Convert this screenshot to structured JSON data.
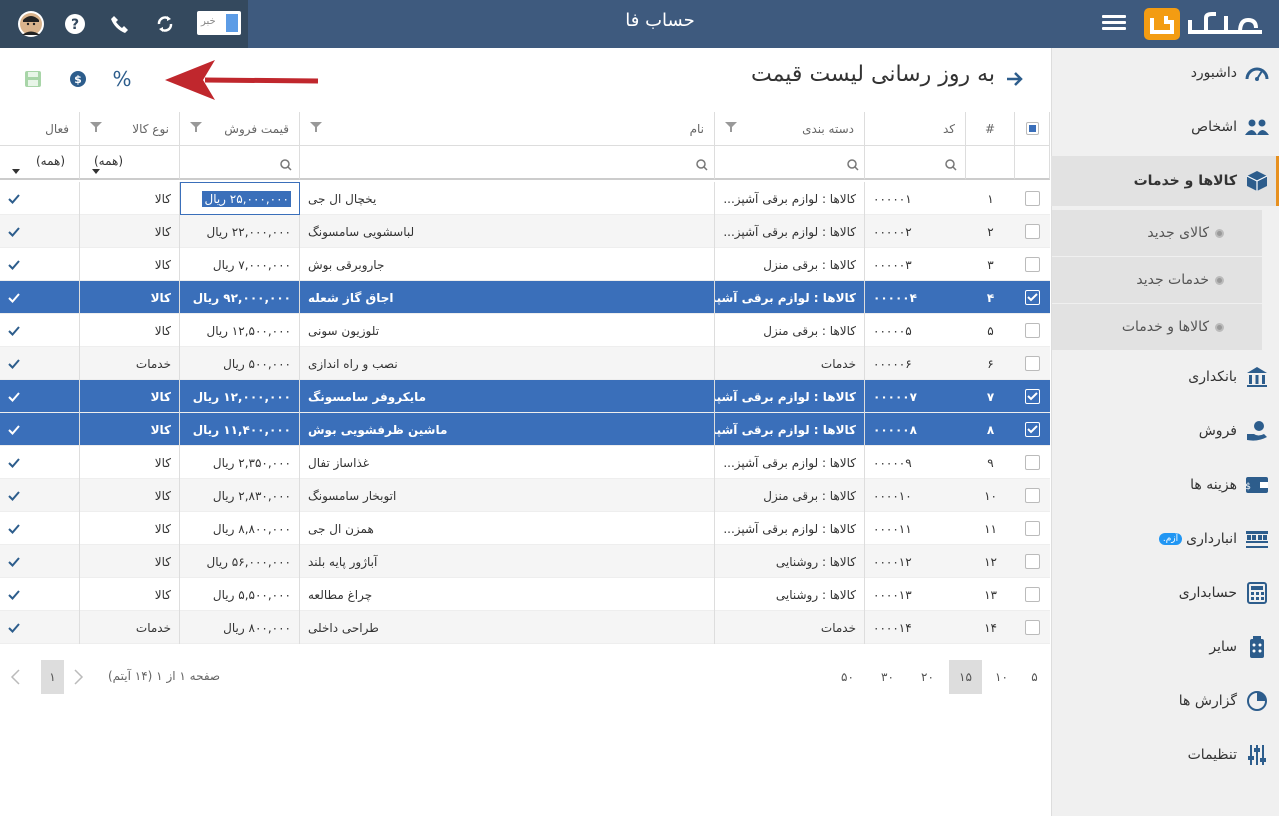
{
  "app": {
    "title": "حساب فا",
    "news_label": "خبر"
  },
  "page": {
    "title": "به روز رسانی لیست قیمت"
  },
  "sidebar": {
    "items": [
      {
        "label": "داشبورد",
        "icon": "dashboard-icon"
      },
      {
        "label": "اشخاص",
        "icon": "people-icon"
      },
      {
        "label": "کالاها و خدمات",
        "icon": "box-icon"
      },
      {
        "label": "بانکداری",
        "icon": "bank-icon"
      },
      {
        "label": "فروش",
        "icon": "sales-icon"
      },
      {
        "label": "هزینه ها",
        "icon": "wallet-icon"
      },
      {
        "label": "انبارداری",
        "icon": "warehouse-icon",
        "badge": "آزم."
      },
      {
        "label": "حسابداری",
        "icon": "calculator-icon"
      },
      {
        "label": "سایر",
        "icon": "other-icon"
      },
      {
        "label": "گزارش ها",
        "icon": "chart-icon"
      },
      {
        "label": "تنظیمات",
        "icon": "sliders-icon"
      }
    ],
    "sub_items": [
      "کالای جدید",
      "خدمات جدید",
      "کالاها و خدمات"
    ]
  },
  "grid": {
    "headers": {
      "num": "#",
      "code": "کد",
      "category": "دسته بندی",
      "name": "نام",
      "price": "قیمت فروش",
      "type": "نوع کالا",
      "active": "فعال"
    },
    "filter_all": "(همه)",
    "rows": [
      {
        "num": "۱",
        "code": "۰۰۰۰۰۱",
        "category": "کالاها : لوازم برقی آشپز...",
        "name": "یخچال ال جی",
        "price": "۲۵,۰۰۰,۰۰۰ ریال",
        "type": "کالا",
        "checked": false
      },
      {
        "num": "۲",
        "code": "۰۰۰۰۰۲",
        "category": "کالاها : لوازم برقی آشپز...",
        "name": "لباسشویی سامسونگ",
        "price": "۲۲,۰۰۰,۰۰۰ ریال",
        "type": "کالا",
        "checked": false
      },
      {
        "num": "۳",
        "code": "۰۰۰۰۰۳",
        "category": "کالاها : برقی منزل",
        "name": "جاروبرقی بوش",
        "price": "۷,۰۰۰,۰۰۰ ریال",
        "type": "کالا",
        "checked": false
      },
      {
        "num": "۴",
        "code": "۰۰۰۰۰۴",
        "category": "کالاها : لوازم برقی آشپز...",
        "name": "اجاق گاز شعله",
        "price": "۹۲,۰۰۰,۰۰۰ ریال",
        "type": "کالا",
        "checked": true
      },
      {
        "num": "۵",
        "code": "۰۰۰۰۰۵",
        "category": "کالاها : برقی منزل",
        "name": "تلوزیون سونی",
        "price": "۱۲,۵۰۰,۰۰۰ ریال",
        "type": "کالا",
        "checked": false
      },
      {
        "num": "۶",
        "code": "۰۰۰۰۰۶",
        "category": "خدمات",
        "name": "نصب و راه اندازی",
        "price": "۵۰۰,۰۰۰ ریال",
        "type": "خدمات",
        "checked": false
      },
      {
        "num": "۷",
        "code": "۰۰۰۰۰۷",
        "category": "کالاها : لوازم برقی آشپز...",
        "name": "مایکروفر سامسونگ",
        "price": "۱۲,۰۰۰,۰۰۰ ریال",
        "type": "کالا",
        "checked": true
      },
      {
        "num": "۸",
        "code": "۰۰۰۰۰۸",
        "category": "کالاها : لوازم برقی آشپز...",
        "name": "ماشین ظرفشویی بوش",
        "price": "۱۱,۴۰۰,۰۰۰ ریال",
        "type": "کالا",
        "checked": true
      },
      {
        "num": "۹",
        "code": "۰۰۰۰۰۹",
        "category": "کالاها : لوازم برقی آشپز...",
        "name": "غذاساز تفال",
        "price": "۲,۳۵۰,۰۰۰ ریال",
        "type": "کالا",
        "checked": false
      },
      {
        "num": "۱۰",
        "code": "۰۰۰۰۱۰",
        "category": "کالاها : برقی منزل",
        "name": "اتوبخار سامسونگ",
        "price": "۲,۸۳۰,۰۰۰ ریال",
        "type": "کالا",
        "checked": false
      },
      {
        "num": "۱۱",
        "code": "۰۰۰۰۱۱",
        "category": "کالاها : لوازم برقی آشپز...",
        "name": "همزن ال جی",
        "price": "۸,۸۰۰,۰۰۰ ریال",
        "type": "کالا",
        "checked": false
      },
      {
        "num": "۱۲",
        "code": "۰۰۰۰۱۲",
        "category": "کالاها : روشنایی",
        "name": "آباژور پایه بلند",
        "price": "۵۶,۰۰۰,۰۰۰ ریال",
        "type": "کالا",
        "checked": false
      },
      {
        "num": "۱۳",
        "code": "۰۰۰۰۱۳",
        "category": "کالاها : روشنایی",
        "name": "چراغ مطالعه",
        "price": "۵,۵۰۰,۰۰۰ ریال",
        "type": "کالا",
        "checked": false
      },
      {
        "num": "۱۴",
        "code": "۰۰۰۰۱۴",
        "category": "خدمات",
        "name": "طراحی داخلی",
        "price": "۸۰۰,۰۰۰ ریال",
        "type": "خدمات",
        "checked": false
      }
    ]
  },
  "pager": {
    "sizes": [
      "۵",
      "۱۰",
      "۱۵",
      "۲۰",
      "۳۰",
      "۵۰"
    ],
    "active_size": "۱۵",
    "info": "صفحه ۱ از ۱ (۱۴ آیتم)",
    "current_page": "۱"
  },
  "toolbar": {
    "percent_label": "%"
  },
  "colors": {
    "topbar": "#3e5a7e",
    "selected_row": "#3a6fba",
    "accent": "#e7901f",
    "arrow": "#c0272d"
  }
}
